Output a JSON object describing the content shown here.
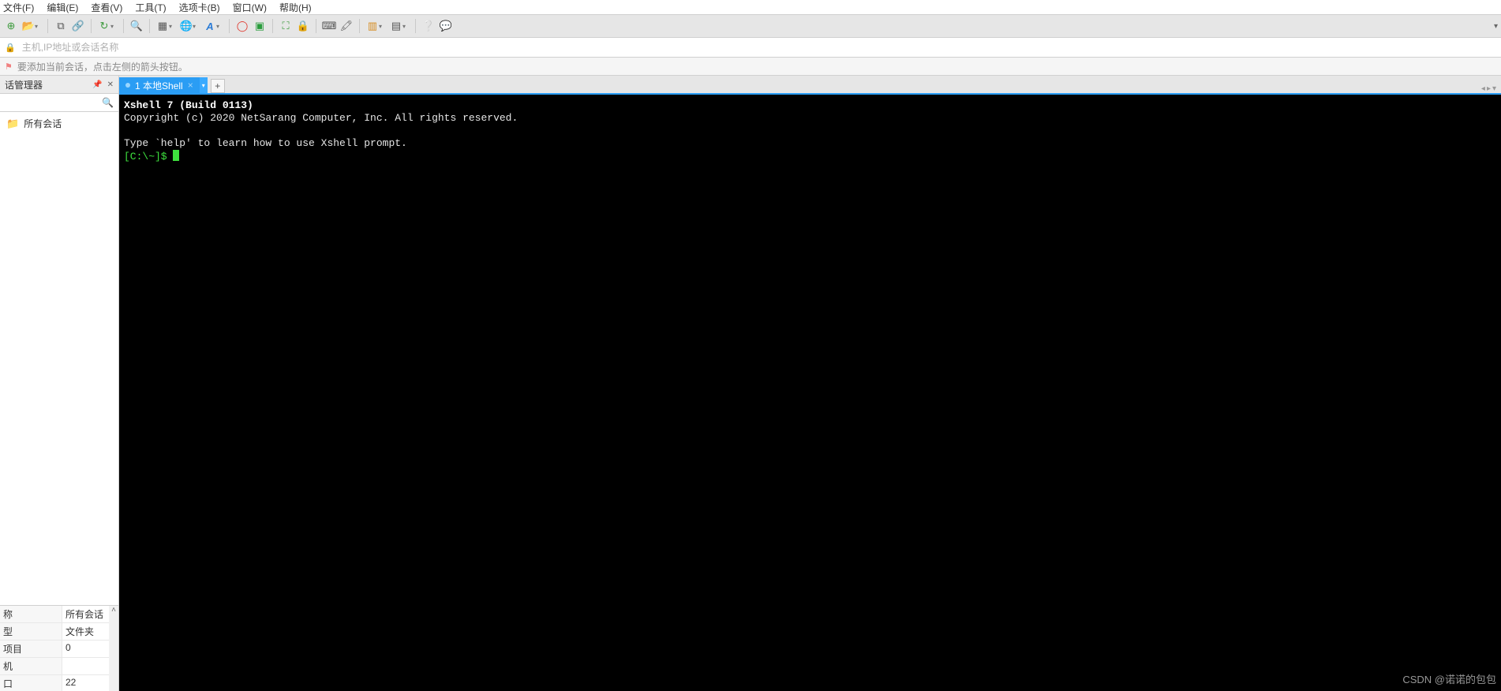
{
  "menu": {
    "file": "文件(F)",
    "edit": "编辑(E)",
    "view": "查看(V)",
    "tools": "工具(T)",
    "tabs": "选项卡(B)",
    "window": "窗口(W)",
    "help": "帮助(H)"
  },
  "address": {
    "placeholder": "主机,IP地址或会话名称"
  },
  "infobar": {
    "hint": "要添加当前会话，点击左侧的箭头按钮。"
  },
  "side": {
    "title": "话管理器",
    "root": "所有会话"
  },
  "props": {
    "rows": [
      {
        "k": "称",
        "v": "所有会话"
      },
      {
        "k": "型",
        "v": "文件夹"
      },
      {
        "k": "项目",
        "v": "0"
      },
      {
        "k": "机",
        "v": ""
      },
      {
        "k": "口",
        "v": "22"
      }
    ]
  },
  "tab": {
    "label": "1 本地Shell"
  },
  "terminal": {
    "line1": "Xshell 7 (Build 0113)",
    "line2": "Copyright (c) 2020 NetSarang Computer, Inc. All rights reserved.",
    "line3": "",
    "line4": "Type `help' to learn how to use Xshell prompt.",
    "prompt": "[C:\\~]$ "
  },
  "watermark": "CSDN @诺诺的包包"
}
